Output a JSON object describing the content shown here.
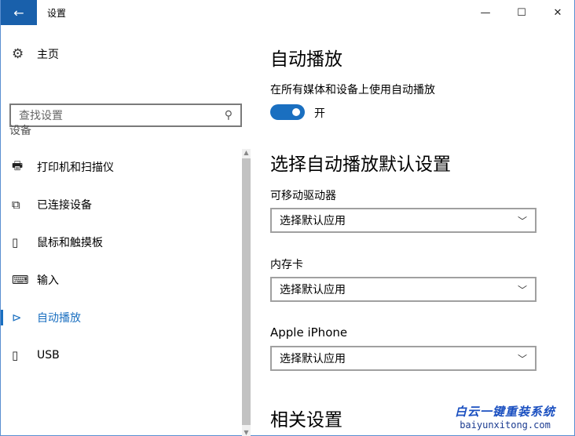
{
  "window": {
    "title": "设置",
    "back_icon": "arrow-left",
    "minimize": "—",
    "maximize": "☐",
    "close": "✕"
  },
  "sidebar": {
    "home": "主页",
    "search_placeholder": "查找设置",
    "group": "设备",
    "items": [
      {
        "label": "打印机和扫描仪",
        "icon": "printer-icon",
        "glyph": "🖶"
      },
      {
        "label": "已连接设备",
        "icon": "devices-icon",
        "glyph": "⧉"
      },
      {
        "label": "鼠标和触摸板",
        "icon": "mouse-icon",
        "glyph": "▯"
      },
      {
        "label": "输入",
        "icon": "keyboard-icon",
        "glyph": "⌨"
      },
      {
        "label": "自动播放",
        "icon": "autoplay-icon",
        "glyph": "⊳",
        "active": true
      },
      {
        "label": "USB",
        "icon": "usb-icon",
        "glyph": "▯"
      }
    ]
  },
  "main": {
    "title": "自动播放",
    "toggle_label": "在所有媒体和设备上使用自动播放",
    "toggle_state": "开",
    "toggle_on": true,
    "defaults_title": "选择自动播放默认设置",
    "dropdowns": [
      {
        "label": "可移动驱动器",
        "value": "选择默认应用"
      },
      {
        "label": "内存卡",
        "value": "选择默认应用"
      },
      {
        "label": "Apple iPhone",
        "value": "选择默认应用"
      }
    ],
    "related_title": "相关设置"
  },
  "watermark": {
    "line1": "白云一键重装系统",
    "line2": "baiyunxitong.com"
  },
  "colors": {
    "accent": "#1a6fc0",
    "back_button": "#1960ab"
  }
}
